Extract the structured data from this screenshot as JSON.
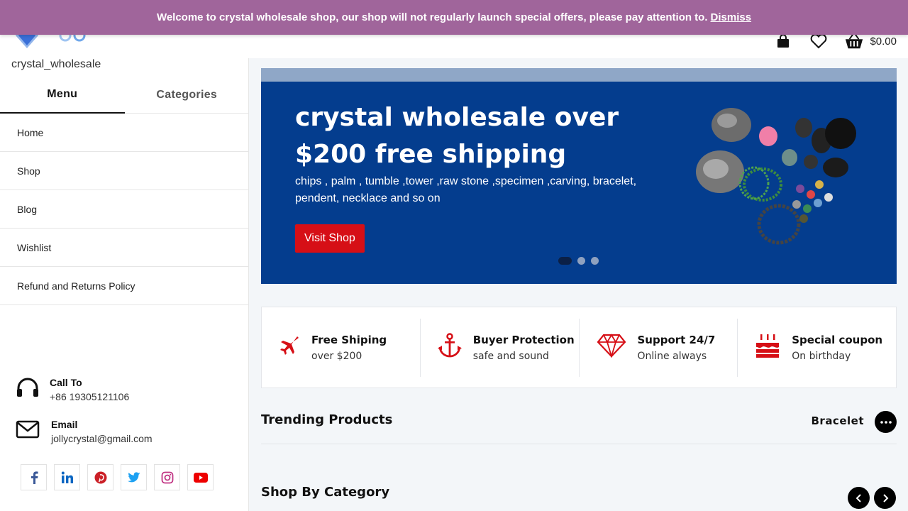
{
  "notice": {
    "message": "Welcome to crystal wholesale shop, our shop will not regularly launch special offers, please pay attention to.",
    "dismiss_label": "Dismiss"
  },
  "header": {
    "brand_name": "crystal_wholesale",
    "cart_total": "$0.00",
    "cart_count": "0",
    "icons": [
      "bag-icon",
      "heart-icon",
      "basket-icon"
    ]
  },
  "sidebar": {
    "tabs": [
      {
        "label": "Menu",
        "active": true
      },
      {
        "label": "Categories",
        "active": false
      }
    ],
    "menu": [
      "Home",
      "Shop",
      "Blog",
      "Wishlist",
      "Refund and Returns Policy"
    ],
    "contacts": [
      {
        "title": "Call To",
        "value": "+86 19305121106",
        "icon": "headphones-icon"
      },
      {
        "title": "Email",
        "value": "jollycrystal@gmail.com",
        "icon": "envelope-icon"
      }
    ],
    "socials": [
      "facebook-icon",
      "linkedin-icon",
      "pinterest-icon",
      "twitter-icon",
      "instagram-icon",
      "youtube-icon"
    ]
  },
  "hero": {
    "headline": "crystal wholesale over $200 free shipping",
    "subtext": "chips , palm , tumble ,tower ,raw stone ,specimen ,carving, bracelet, pendent, necklace and so on",
    "button_label": "Visit Shop",
    "slide_count": 3,
    "active_slide": 1,
    "colors": {
      "background": "#043d8e",
      "button": "#d60f16"
    }
  },
  "features": [
    {
      "title": "Free Shiping",
      "subtitle": "over $200",
      "icon": "airplane-icon"
    },
    {
      "title": "Buyer Protection",
      "subtitle": "safe and sound",
      "icon": "anchor-icon"
    },
    {
      "title": "Support 24/7",
      "subtitle": "Online always",
      "icon": "diamond-icon"
    },
    {
      "title": "Special coupon",
      "subtitle": "On birthday",
      "icon": "cake-icon"
    }
  ],
  "trending": {
    "title": "Trending Products",
    "category": "Bracelet"
  },
  "shop_by_category": {
    "title": "Shop By Category"
  },
  "accent_colors": {
    "notice": "#a0659b",
    "feature_icon": "#d60f16"
  }
}
